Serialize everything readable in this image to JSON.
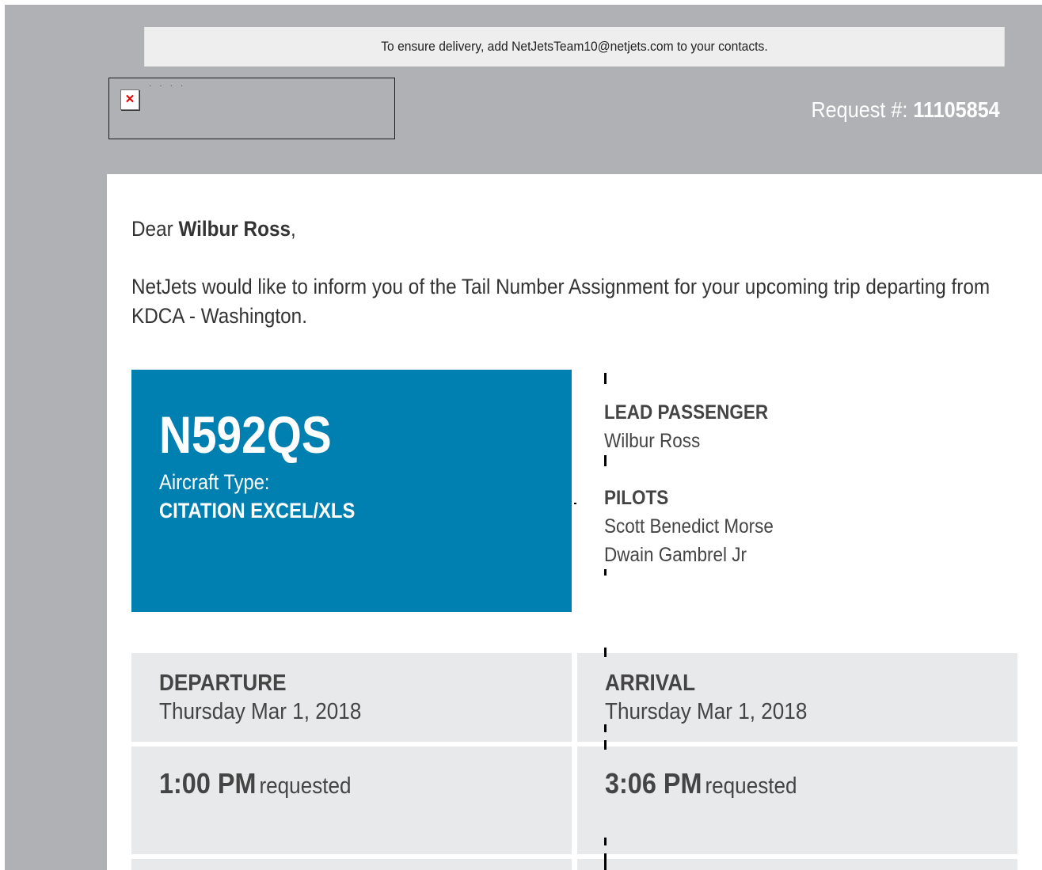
{
  "banner": {
    "notice": "To ensure delivery, add NetJetsTeam10@netjets.com to your contacts."
  },
  "header": {
    "request_label": "Request #:",
    "request_number": "11105854",
    "logo_icon": "broken-image-icon"
  },
  "message": {
    "greeting_prefix": "Dear",
    "recipient_name": "Wilbur Ross",
    "greeting_suffix": ",",
    "intro": "NetJets would like to inform you of the Tail Number Assignment for your upcoming trip departing from KDCA - Washington."
  },
  "aircraft": {
    "tail_number": "N592QS",
    "type_label": "Aircraft Type:",
    "type_value": "CITATION EXCEL/XLS"
  },
  "passengers": {
    "lead_label": "LEAD PASSENGER",
    "lead_name": "Wilbur Ross",
    "pilots_label": "PILOTS",
    "pilots": [
      "Scott Benedict Morse",
      "Dwain Gambrel Jr"
    ]
  },
  "departure": {
    "label": "DEPARTURE",
    "date": "Thursday Mar 1, 2018",
    "time": "1:00 PM",
    "time_note": "requested"
  },
  "arrival": {
    "label": "ARRIVAL",
    "date": "Thursday Mar 1, 2018",
    "time": "3:06 PM",
    "time_note": "requested"
  },
  "colors": {
    "accent_blue": "#0080b0",
    "header_gray": "#b0b1b4",
    "cell_gray": "#e8e9ea"
  }
}
